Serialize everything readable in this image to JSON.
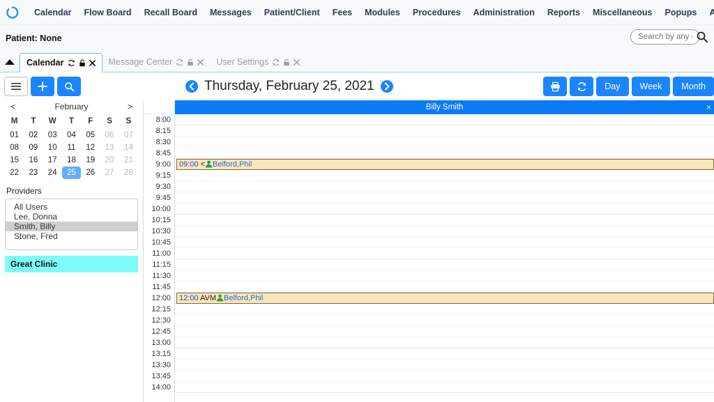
{
  "topnav": {
    "logo_icon": "circle-loader-icon",
    "items": [
      {
        "label": "Calendar"
      },
      {
        "label": "Flow Board"
      },
      {
        "label": "Recall Board"
      },
      {
        "label": "Messages"
      },
      {
        "label": "Patient/Client"
      },
      {
        "label": "Fees"
      },
      {
        "label": "Modules"
      },
      {
        "label": "Procedures"
      },
      {
        "label": "Administration"
      },
      {
        "label": "Reports"
      },
      {
        "label": "Miscellaneous"
      },
      {
        "label": "Popups"
      },
      {
        "label": "About"
      },
      {
        "label": "Billy Smith"
      }
    ]
  },
  "patientbar": {
    "label": "Patient: None",
    "search_placeholder": "Search by any de",
    "search_value": "",
    "search_icon": "search-icon"
  },
  "tabstrip": {
    "collapse_icon": "triangle-up-icon",
    "tabs": [
      {
        "label": "Calendar",
        "active": true
      },
      {
        "label": "Message Center",
        "active": false
      },
      {
        "label": "User Settings",
        "active": false
      }
    ],
    "tab_icons": [
      "refresh-icon",
      "lock-icon",
      "close-icon"
    ]
  },
  "toolbar": {
    "menu_icon": "hamburger-menu-icon",
    "add_label": "+",
    "search_icon": "search-icon",
    "prev_icon": "chevron-left-circle-icon",
    "next_icon": "chevron-right-circle-icon",
    "date_title": "Thursday, February 25, 2021",
    "print_icon": "printer-icon",
    "refresh_icon": "refresh-icon",
    "day_label": "Day",
    "week_label": "Week",
    "month_label": "Month"
  },
  "sidebar": {
    "mini_calendar": {
      "prev_label": "<",
      "next_label": ">",
      "month": "February",
      "weekdays": [
        "M",
        "T",
        "W",
        "T",
        "F",
        "S",
        "S"
      ],
      "weeks": [
        [
          {
            "d": "01"
          },
          {
            "d": "02"
          },
          {
            "d": "03"
          },
          {
            "d": "04"
          },
          {
            "d": "05"
          },
          {
            "d": "06",
            "we": true
          },
          {
            "d": "07",
            "we": true
          }
        ],
        [
          {
            "d": "08"
          },
          {
            "d": "09"
          },
          {
            "d": "10"
          },
          {
            "d": "11"
          },
          {
            "d": "12"
          },
          {
            "d": "13",
            "we": true
          },
          {
            "d": "14",
            "we": true
          }
        ],
        [
          {
            "d": "15"
          },
          {
            "d": "16"
          },
          {
            "d": "17"
          },
          {
            "d": "18"
          },
          {
            "d": "19"
          },
          {
            "d": "20",
            "we": true
          },
          {
            "d": "21",
            "we": true
          }
        ],
        [
          {
            "d": "22"
          },
          {
            "d": "23"
          },
          {
            "d": "24"
          },
          {
            "d": "25",
            "sel": true
          },
          {
            "d": "26"
          },
          {
            "d": "27",
            "we": true
          },
          {
            "d": "28",
            "we": true
          }
        ]
      ]
    },
    "providers_label": "Providers",
    "providers": [
      {
        "label": "All Users",
        "selected": false
      },
      {
        "label": "Lee, Donna",
        "selected": false
      },
      {
        "label": "Smith, Billy",
        "selected": true
      },
      {
        "label": "Stone, Fred",
        "selected": false
      }
    ],
    "clinic": "Great Clinic"
  },
  "calendar": {
    "provider_header": "Billy Smith",
    "provider_header_close": "×",
    "times": [
      "8:00",
      "8:15",
      "8:30",
      "8:45",
      "9:00",
      "9:15",
      "9:30",
      "9:45",
      "10:00",
      "10:15",
      "10:30",
      "10:45",
      "11:00",
      "11:15",
      "11:30",
      "11:45",
      "12:00",
      "12:15",
      "12:30",
      "12:45",
      "13:00",
      "13:15",
      "13:30",
      "13:45",
      "14:00"
    ],
    "appointments": [
      {
        "time": "09:00",
        "lt": "<",
        "code": "",
        "patient": "Belford,Phil",
        "slot_index": 4
      },
      {
        "time": "12:00",
        "lt": "",
        "code": "AVM",
        "patient": "Belford,Phil",
        "slot_index": 16
      }
    ],
    "person_icon": "person-icon"
  },
  "colors": {
    "accent_blue": "#1a85ff",
    "header_blue": "#0b7bf5",
    "selected_day": "#64b0fb",
    "clinic_cyan": "#7dfcfc",
    "appointment_bg": "#fae6bb",
    "provider_selected": "#cfcfcf"
  }
}
